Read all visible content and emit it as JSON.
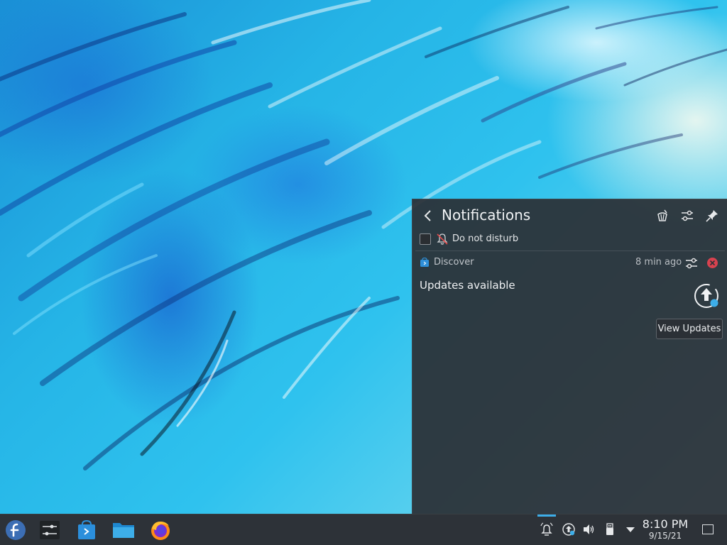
{
  "notifications_panel": {
    "title": "Notifications",
    "header_icons": [
      "clear-history-icon",
      "configure-icon",
      "pin-icon"
    ],
    "do_not_disturb": {
      "label": "Do not disturb",
      "checked": false
    },
    "notification": {
      "app_name": "Discover",
      "time_ago": "8 min ago",
      "summary": "Updates available",
      "action_label": "View Updates"
    }
  },
  "taskbar": {
    "launchers": [
      "fedora-launcher-icon",
      "system-settings-icon",
      "discover-icon",
      "file-manager-icon",
      "firefox-icon"
    ],
    "tray_icons": [
      "notifications-icon",
      "updates-icon",
      "volume-icon",
      "usb-device-icon",
      "expand-tray-icon"
    ],
    "clock": {
      "time": "8:10 PM",
      "date": "9/15/21"
    }
  },
  "colors": {
    "accent": "#3daee9",
    "panel_bg": "#2c3137",
    "close_red": "#d8424f"
  }
}
